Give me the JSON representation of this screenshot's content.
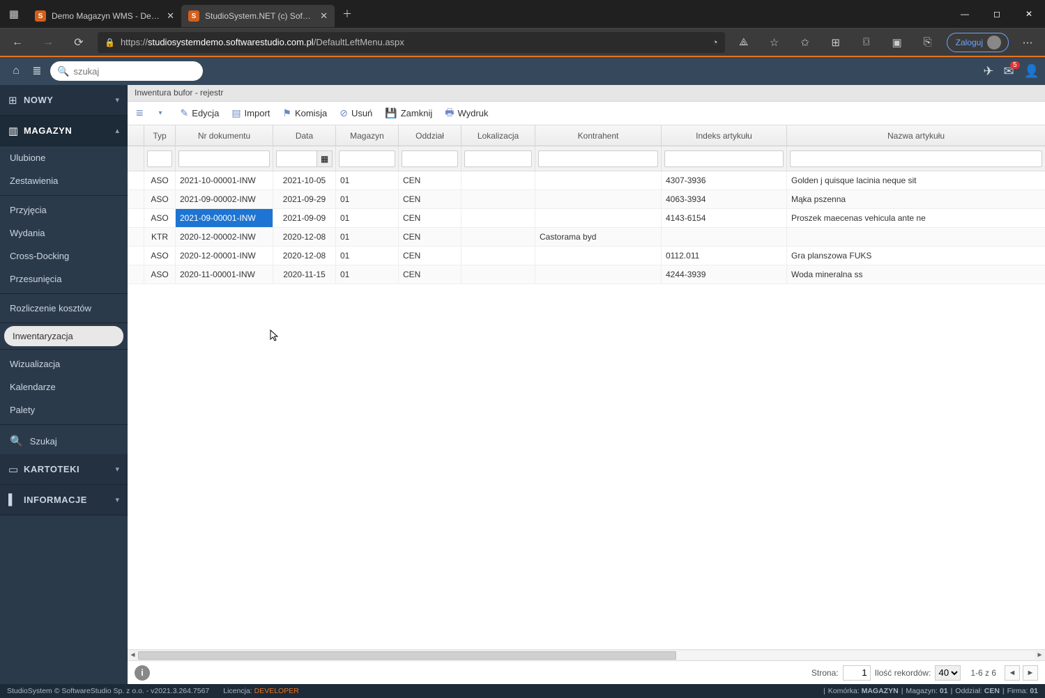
{
  "browser": {
    "tabs": [
      {
        "label": "Demo Magazyn WMS - Demo o",
        "active": false
      },
      {
        "label": "StudioSystem.NET (c) SoftwareSt",
        "active": true
      }
    ],
    "url_prefix": "https://",
    "url_host": "studiosystemdemo.softwarestudio.com.pl",
    "url_path": "/DefaultLeftMenu.aspx",
    "login_label": "Zaloguj"
  },
  "header": {
    "search_placeholder": "szukaj",
    "mail_badge": "5"
  },
  "sidebar": {
    "sections": {
      "nowy": "NOWY",
      "magazyn": "MAGAZYN",
      "kartoteki": "KARTOTEKI",
      "informacje": "INFORMACJE"
    },
    "magazyn_items": [
      "Ulubione",
      "Zestawienia",
      "Przyjęcia",
      "Wydania",
      "Cross-Docking",
      "Przesunięcia",
      "Rozliczenie kosztów",
      "Inwentaryzacja",
      "Wizualizacja",
      "Kalendarze",
      "Palety"
    ],
    "selected": "Inwentaryzacja",
    "search_label": "Szukaj"
  },
  "crumb": "Inwentura bufor - rejestr",
  "toolbar": {
    "edycja": "Edycja",
    "import": "Import",
    "komisja": "Komisja",
    "usun": "Usuń",
    "zamknij": "Zamknij",
    "wydruk": "Wydruk"
  },
  "columns": [
    "Typ",
    "Nr dokumentu",
    "Data",
    "Magazyn",
    "Oddział",
    "Lokalizacja",
    "Kontrahent",
    "Indeks artykułu",
    "Nazwa artykułu"
  ],
  "rows": [
    {
      "typ": "ASO",
      "nr": "2021-10-00001-INW",
      "data": "2021-10-05",
      "mag": "01",
      "odd": "CEN",
      "lok": "",
      "kon": "",
      "ind": "4307-3936",
      "naz": "Golden j quisque lacinia neque sit"
    },
    {
      "typ": "ASO",
      "nr": "2021-09-00002-INW",
      "data": "2021-09-29",
      "mag": "01",
      "odd": "CEN",
      "lok": "",
      "kon": "",
      "ind": "4063-3934",
      "naz": "Mąka pszenna"
    },
    {
      "typ": "ASO",
      "nr": "2021-09-00001-INW",
      "data": "2021-09-09",
      "mag": "01",
      "odd": "CEN",
      "lok": "",
      "kon": "",
      "ind": "4143-6154",
      "naz": "Proszek maecenas vehicula ante ne",
      "sel": true
    },
    {
      "typ": "KTR",
      "nr": "2020-12-00002-INW",
      "data": "2020-12-08",
      "mag": "01",
      "odd": "CEN",
      "lok": "",
      "kon": "Castorama byd",
      "ind": "",
      "naz": ""
    },
    {
      "typ": "ASO",
      "nr": "2020-12-00001-INW",
      "data": "2020-12-08",
      "mag": "01",
      "odd": "CEN",
      "lok": "",
      "kon": "",
      "ind": "0112.011",
      "naz": "Gra planszowa FUKS"
    },
    {
      "typ": "ASO",
      "nr": "2020-11-00001-INW",
      "data": "2020-11-15",
      "mag": "01",
      "odd": "CEN",
      "lok": "",
      "kon": "",
      "ind": "4244-3939",
      "naz": "Woda mineralna ss"
    }
  ],
  "pager": {
    "strona_label": "Strona:",
    "strona_value": "1",
    "ilosc_label": "Ilość rekordów:",
    "page_size": "40",
    "range": "1-6 z 6"
  },
  "footer": {
    "left": "StudioSystem © SoftwareStudio Sp. z o.o. - v2021.3.264.7567",
    "lic_label": "Licencja: ",
    "lic_value": "DEVELOPER",
    "komorka_label": "Komórka: ",
    "komorka": "MAGAZYN",
    "mag_label": "Magazyn: ",
    "mag": "01",
    "odd_label": "Oddział: ",
    "odd": "CEN",
    "firma_label": "Firma: ",
    "firma": "01"
  }
}
